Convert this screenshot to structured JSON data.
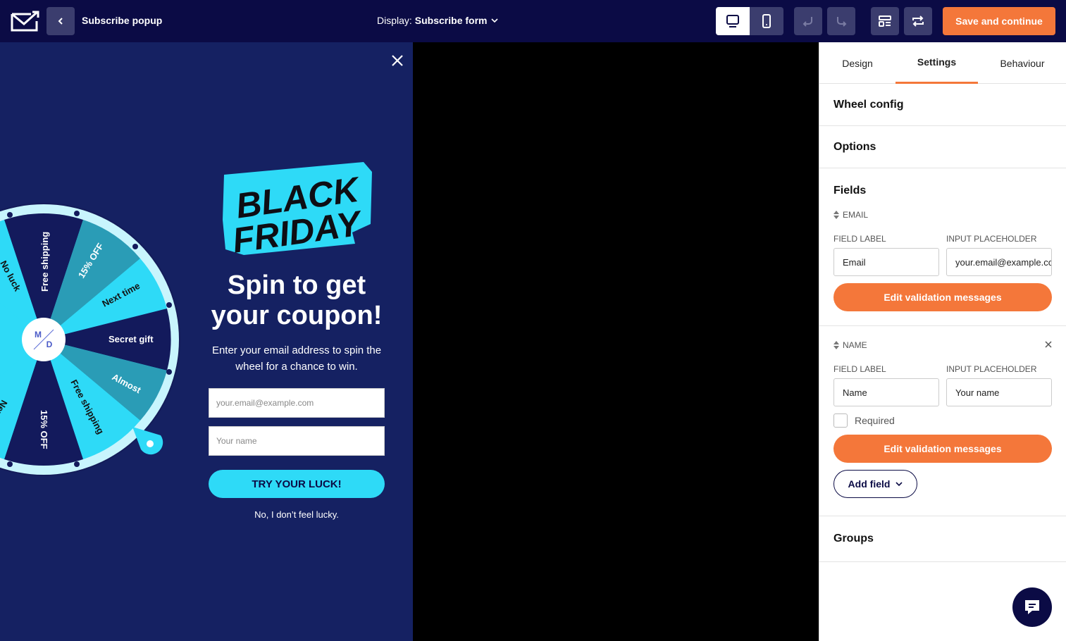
{
  "header": {
    "title": "Subscribe popup",
    "display_prefix": "Display:",
    "display_value": "Subscribe form",
    "save_label": "Save and continue"
  },
  "popup": {
    "logo_line1": "BLACK",
    "logo_line2": "FRIDAY",
    "headline_line1": "Spin to get",
    "headline_line2": "your coupon!",
    "subtext": "Enter your email address to spin the wheel for a chance to win.",
    "email_placeholder": "your.email@example.com",
    "name_placeholder": "Your name",
    "cta_label": "TRY YOUR LUCK!",
    "decline_label": "No, I don’t feel lucky.",
    "wheel_center_top": "M",
    "wheel_center_bottom": "D",
    "wheel_segments": [
      "Free shipping",
      "15% OFF",
      "Next time",
      "Secret gift",
      "Almost",
      "Free shipping",
      "15% OFF",
      "Next",
      "No luck"
    ]
  },
  "panel": {
    "tabs": [
      "Design",
      "Settings",
      "Behaviour"
    ],
    "active_tab": "Settings",
    "sections": {
      "wheel_config": "Wheel config",
      "options": "Options",
      "fields": "Fields",
      "groups": "Groups"
    },
    "email_field": {
      "heading": "EMAIL",
      "label_caption": "FIELD LABEL",
      "placeholder_caption": "INPUT PLACEHOLDER",
      "label_value": "Email",
      "placeholder_value": "your.email@example.com",
      "validation_btn": "Edit validation messages"
    },
    "name_field": {
      "heading": "NAME",
      "label_caption": "FIELD LABEL",
      "placeholder_caption": "INPUT PLACEHOLDER",
      "label_value": "Name",
      "placeholder_value": "Your name",
      "required_label": "Required",
      "validation_btn": "Edit validation messages"
    },
    "add_field_label": "Add field"
  },
  "colors": {
    "topbar": "#0b0b45",
    "accent": "#f4773a",
    "popup_bg": "#152162",
    "cyan": "#2edaf7"
  }
}
